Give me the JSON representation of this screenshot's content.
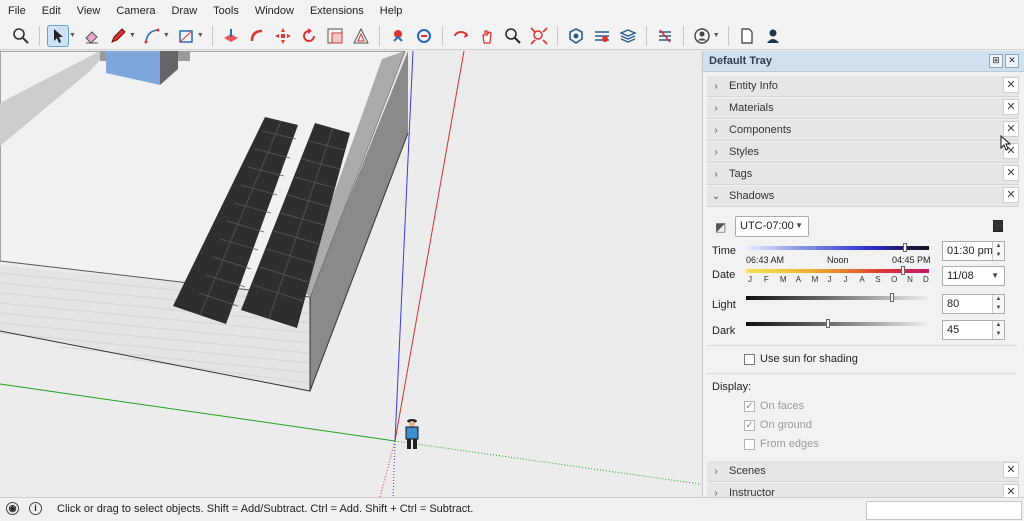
{
  "menu": [
    "File",
    "Edit",
    "View",
    "Camera",
    "Draw",
    "Tools",
    "Window",
    "Extensions",
    "Help"
  ],
  "toolbar": {
    "icons": [
      "zoom-icon",
      "select-icon",
      "eraser-icon",
      "pencil-icon",
      "arc-icon",
      "rectangle-icon",
      "push-pull-icon",
      "follow-me-icon",
      "move-icon",
      "rotate-icon",
      "scale-icon",
      "offset-icon",
      "position-camera-icon",
      "walk-icon",
      "orbit-icon",
      "pan-icon",
      "zoom-window-icon",
      "zoom-extents-icon",
      "warehouse-icon",
      "extension-warehouse-icon",
      "layout-icon",
      "solid-tools-icon",
      "profile-icon",
      "new-file-icon",
      "user-icon"
    ]
  },
  "tray": {
    "title": "Default Tray",
    "panels": {
      "entity_info": "Entity Info",
      "materials": "Materials",
      "components": "Components",
      "styles": "Styles",
      "tags": "Tags",
      "shadows": "Shadows",
      "scenes": "Scenes",
      "instructor": "Instructor"
    }
  },
  "shadows": {
    "timezone": "UTC-07:00",
    "time_label": "Time",
    "time_start": "06:43 AM",
    "time_noon": "Noon",
    "time_end": "04:45 PM",
    "time_value": "01:30 pm",
    "time_fraction": 0.87,
    "date_label": "Date",
    "months": [
      "J",
      "F",
      "M",
      "A",
      "M",
      "J",
      "J",
      "A",
      "S",
      "O",
      "N",
      "D"
    ],
    "date_value": "11/08",
    "date_fraction": 0.86,
    "light_label": "Light",
    "light_value": "80",
    "dark_label": "Dark",
    "dark_value": "45",
    "use_sun_label": "Use sun for shading",
    "use_sun_checked": false,
    "display_label": "Display:",
    "on_faces_label": "On faces",
    "on_faces_checked": true,
    "on_ground_label": "On ground",
    "on_ground_checked": true,
    "from_edges_label": "From edges",
    "from_edges_checked": false
  },
  "status": {
    "message": "Click or drag to select objects. Shift = Add/Subtract. Ctrl = Add. Shift + Ctrl = Subtract."
  }
}
